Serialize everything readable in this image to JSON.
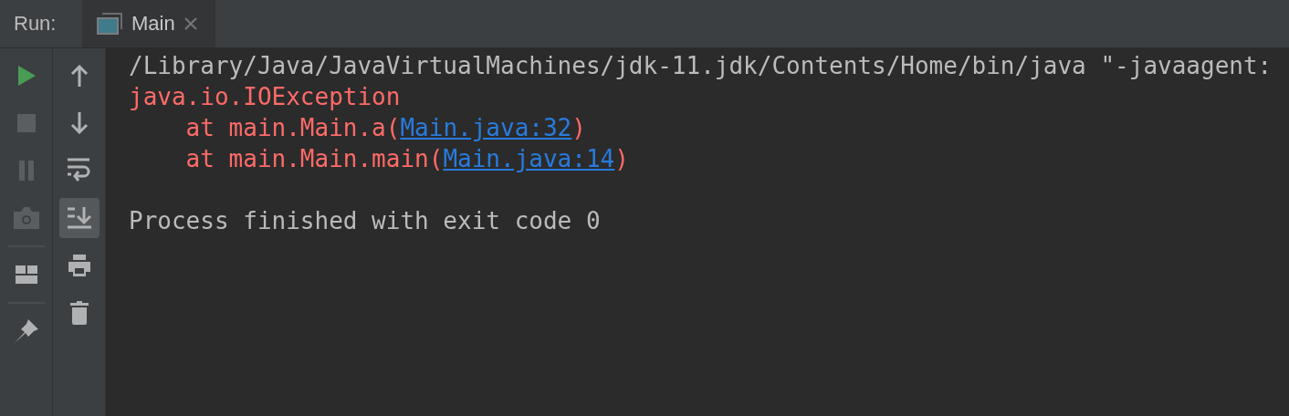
{
  "run_bar": {
    "label": "Run:",
    "tabs": [
      {
        "title": "Main",
        "selected": true
      }
    ]
  },
  "left_toolbar": [
    {
      "disabled": false
    },
    {
      "disabled": true
    },
    {
      "disabled": true
    },
    {
      "disabled": true
    },
    {
      "disabled": false
    },
    {
      "disabled": false
    }
  ],
  "right_toolbar": [
    {
      "on": false
    },
    {
      "on": false
    },
    {
      "on": false
    },
    {
      "on": true
    },
    {
      "on": false
    },
    {
      "on": false
    }
  ],
  "console": {
    "lines": [
      {
        "kind": "command",
        "text": "/Library/Java/JavaVirtualMachines/jdk-11.jdk/Contents/Home/bin/java \"-javaagent:"
      },
      {
        "kind": "error",
        "text": "java.io.IOException"
      },
      {
        "kind": "error",
        "text": "    at main.Main.a(",
        "link": "Main.java:32",
        "after": ")"
      },
      {
        "kind": "error",
        "text": "    at main.Main.main(",
        "link": "Main.java:14",
        "after": ")"
      },
      {
        "kind": "exit",
        "text": "Process finished with exit code 0"
      }
    ]
  }
}
